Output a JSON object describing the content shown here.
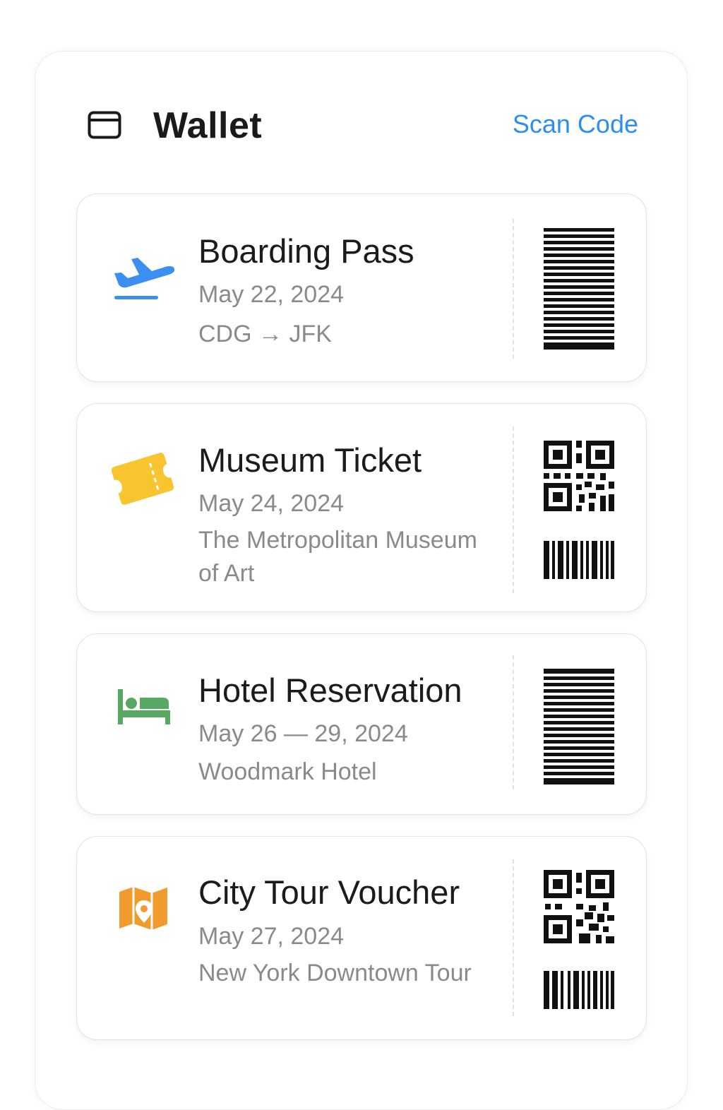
{
  "header": {
    "title": "Wallet",
    "wallet_icon": "wallet-card-icon",
    "scan_label": "Scan Code"
  },
  "colors": {
    "accent": "#2d8ef0",
    "plane": "#3b8ff0",
    "ticket": "#f8c42f",
    "hotel": "#57a862",
    "map": "#f29b2d"
  },
  "passes": [
    {
      "icon": "airplane-departure-icon",
      "title": "Boarding Pass",
      "date": "May 22, 2024",
      "detail": "CDG → JFK",
      "code": "barcode"
    },
    {
      "icon": "ticket-icon",
      "title": "Museum Ticket",
      "date": "May 24, 2024",
      "detail": "The Metropolitan Museum of Art",
      "code": "qr-code-with-barcode"
    },
    {
      "icon": "bed-icon",
      "title": "Hotel Reservation",
      "date": "May 26 — 29, 2024",
      "detail": "Woodmark Hotel",
      "code": "barcode"
    },
    {
      "icon": "map-pin-icon",
      "title": "City Tour Voucher",
      "date": "May 27, 2024",
      "detail": "New York Downtown Tour",
      "code": "qr-code-with-barcode"
    }
  ]
}
